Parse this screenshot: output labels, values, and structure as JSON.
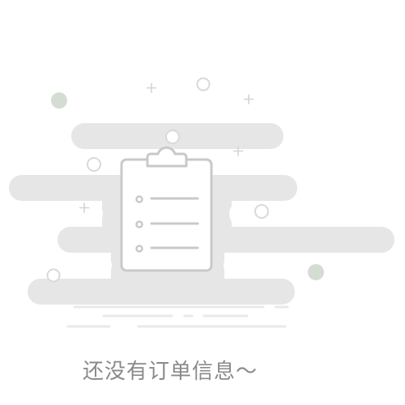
{
  "empty_state": {
    "message": "还没有订单信息～",
    "illustration_icon": "clipboard-icon"
  },
  "colors": {
    "cloud": "#e6e6e6",
    "clipboard_border": "#c9c9c9",
    "dot_green": "#d4ddd2",
    "ring": "#d9d9d9",
    "text": "#8a8a8a"
  }
}
